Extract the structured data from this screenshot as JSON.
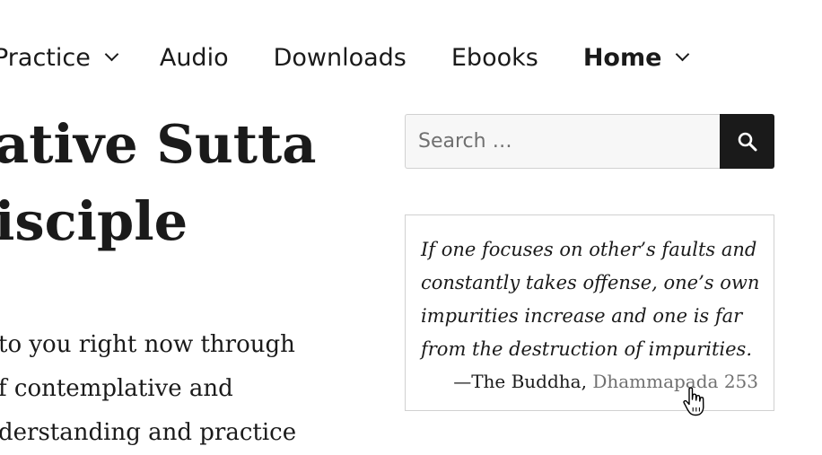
{
  "nav": {
    "items": [
      {
        "label": "Practice",
        "has_dropdown": true
      },
      {
        "label": "Audio",
        "has_dropdown": false
      },
      {
        "label": "Downloads",
        "has_dropdown": false
      },
      {
        "label": "Ebooks",
        "has_dropdown": false
      },
      {
        "label": "Home",
        "has_dropdown": true,
        "active": true
      }
    ]
  },
  "page": {
    "title_lines": [
      "ative Sutta",
      "isciple"
    ],
    "body_lines": [
      " to you right now through",
      "f contemplative and",
      "derstanding and practice"
    ]
  },
  "search": {
    "placeholder": "Search …",
    "button_icon": "search-icon"
  },
  "quote": {
    "lines": [
      "If one focuses on other’s faults and",
      "constantly takes offense, one’s own",
      "impurities increase and one is far",
      "from the destruction of impurities."
    ],
    "attribution_prefix": "—The Buddha, ",
    "source_link": "Dhammapada 253"
  },
  "colors": {
    "text": "#1a1a1a",
    "link": "#707070",
    "search_button_bg": "#1a1a1a",
    "border": "#d1d1d1"
  }
}
